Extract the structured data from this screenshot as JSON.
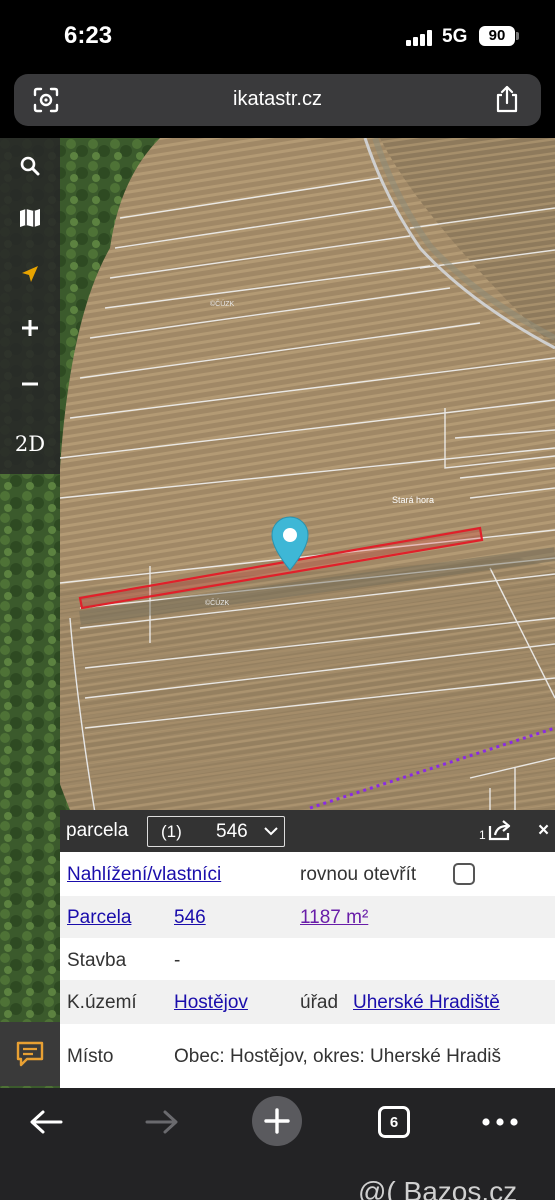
{
  "status_bar": {
    "time": "6:23",
    "network": "5G",
    "battery": "90"
  },
  "browser": {
    "url": "ikatastr.cz",
    "tab_count": "6"
  },
  "map": {
    "locality_label": "Stará hora",
    "watermark_label": "©ČÚZK",
    "parcel_line_color": "#e0202a"
  },
  "toolbar": {
    "mode_2d": "2D"
  },
  "panel": {
    "title": "parcela",
    "selector_index": "(1)",
    "selector_value": "546",
    "result_count": "1",
    "close_label": "×",
    "rows": {
      "nahlizeni": "Nahlížení/vlastníci",
      "open_directly": "rovnou otevřít",
      "parcela_label": "Parcela",
      "parcela_number": "546",
      "area": "1187 m²",
      "stavba_label": "Stavba",
      "stavba_value": "-",
      "uzemi_label": "K.území",
      "uzemi_value": "Hostějov",
      "urad_label": "úřad",
      "urad_value": "Uherské Hradiště",
      "misto_label": "Místo",
      "misto_value": "Obec: Hostějov, okres: Uherské Hradiš"
    }
  },
  "watermark": "@( Bazos.cz"
}
